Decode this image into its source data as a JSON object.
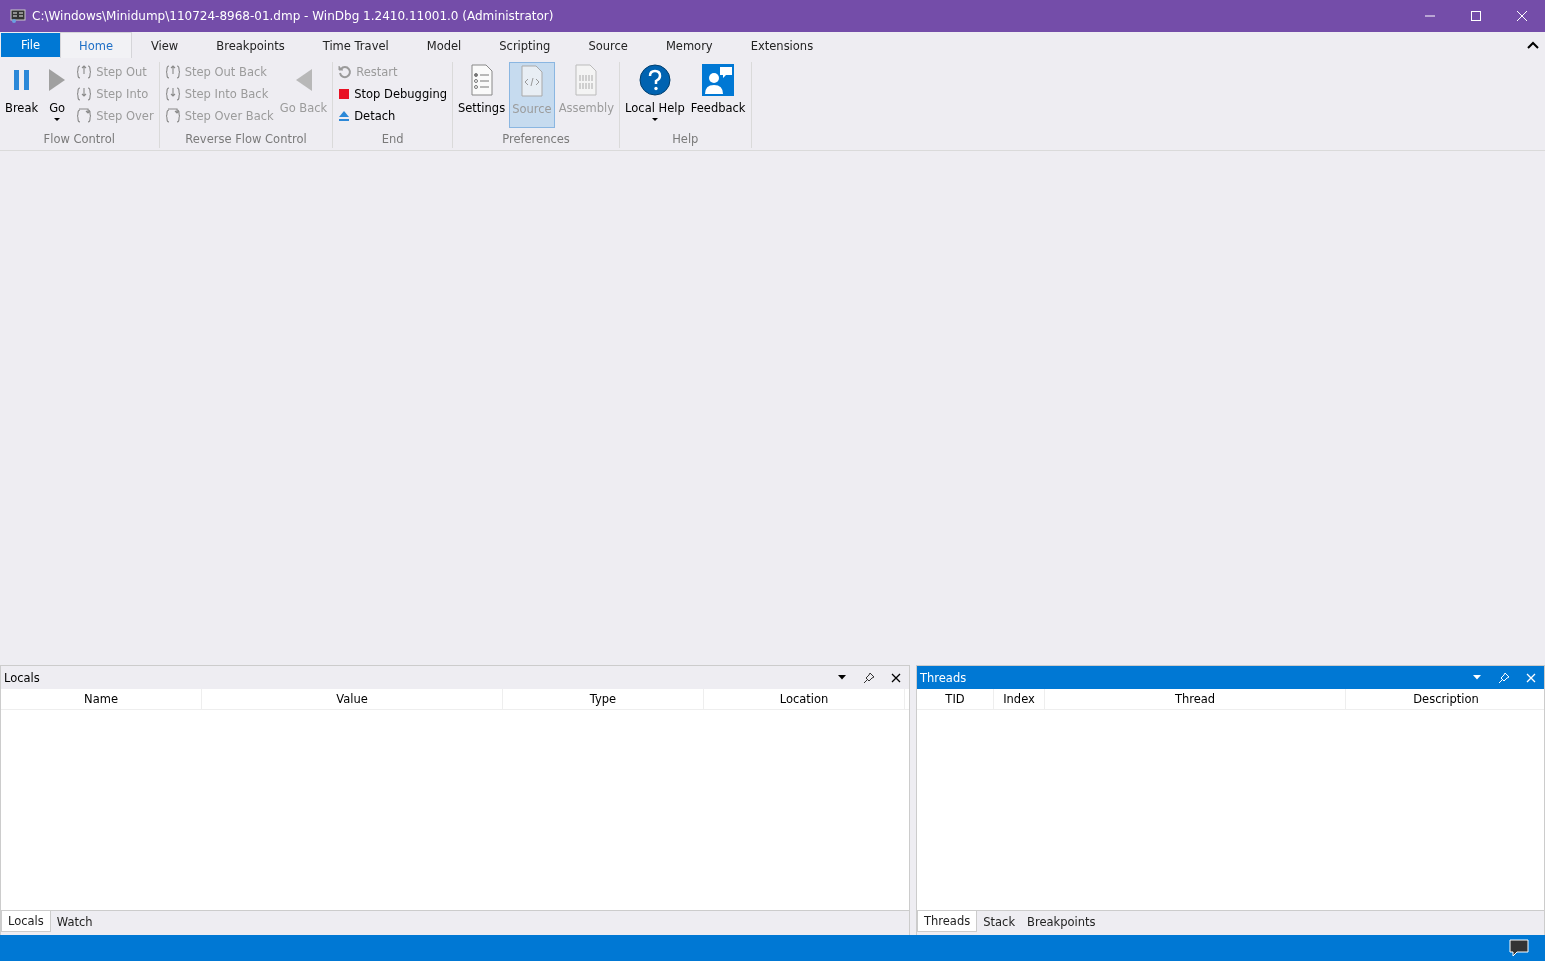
{
  "window": {
    "title": "C:\\Windows\\Minidump\\110724-8968-01.dmp - WinDbg 1.2410.11001.0 (Administrator)"
  },
  "ribbon": {
    "tabs": [
      {
        "label": "File",
        "kind": "file",
        "selected": false
      },
      {
        "label": "Home",
        "kind": "tab",
        "selected": true
      },
      {
        "label": "View",
        "kind": "tab",
        "selected": false
      },
      {
        "label": "Breakpoints",
        "kind": "tab",
        "selected": false
      },
      {
        "label": "Time Travel",
        "kind": "tab",
        "selected": false
      },
      {
        "label": "Model",
        "kind": "tab",
        "selected": false
      },
      {
        "label": "Scripting",
        "kind": "tab",
        "selected": false
      },
      {
        "label": "Source",
        "kind": "tab",
        "selected": false
      },
      {
        "label": "Memory",
        "kind": "tab",
        "selected": false
      },
      {
        "label": "Extensions",
        "kind": "tab",
        "selected": false
      }
    ],
    "groups": [
      {
        "label": "Flow Control",
        "items": [
          {
            "label": "Break",
            "kind": "large",
            "disabled": false
          },
          {
            "label": "Go",
            "kind": "large",
            "disabled": false,
            "dropdown": true
          },
          {
            "label": "Step Out",
            "kind": "small",
            "disabled": true
          },
          {
            "label": "Step Into",
            "kind": "small",
            "disabled": true
          },
          {
            "label": "Step Over",
            "kind": "small",
            "disabled": true
          }
        ]
      },
      {
        "label": "Reverse Flow Control",
        "items": [
          {
            "label": "Step Out Back",
            "kind": "small",
            "disabled": true
          },
          {
            "label": "Step Into Back",
            "kind": "small",
            "disabled": true
          },
          {
            "label": "Step Over Back",
            "kind": "small",
            "disabled": true
          },
          {
            "label": "Go Back",
            "kind": "large",
            "disabled": true
          }
        ]
      },
      {
        "label": "End",
        "items": [
          {
            "label": "Restart",
            "kind": "small",
            "disabled": true
          },
          {
            "label": "Stop Debugging",
            "kind": "small",
            "disabled": false
          },
          {
            "label": "Detach",
            "kind": "small",
            "disabled": false
          }
        ]
      },
      {
        "label": "Preferences",
        "items": [
          {
            "label": "Settings",
            "kind": "large",
            "disabled": false,
            "selected": false
          },
          {
            "label": "Source",
            "kind": "large",
            "disabled": true,
            "selected": true
          },
          {
            "label": "Assembly",
            "kind": "large",
            "disabled": true,
            "selected": false
          }
        ]
      },
      {
        "label": "Help",
        "items": [
          {
            "label": "Local Help",
            "kind": "large",
            "disabled": false,
            "dropdown": true
          },
          {
            "label": "Feedback",
            "kind": "large",
            "disabled": false
          }
        ]
      }
    ]
  },
  "panels": [
    {
      "title": "Locals",
      "active": false,
      "columns": [
        "Name",
        "Value",
        "Type",
        "Location"
      ],
      "tabs": [
        {
          "label": "Locals",
          "selected": true
        },
        {
          "label": "Watch",
          "selected": false
        }
      ]
    },
    {
      "title": "Threads",
      "active": true,
      "columns": [
        "TID",
        "Index",
        "Thread",
        "Description"
      ],
      "tabs": [
        {
          "label": "Threads",
          "selected": true
        },
        {
          "label": "Stack",
          "selected": false
        },
        {
          "label": "Breakpoints",
          "selected": false
        }
      ]
    }
  ]
}
